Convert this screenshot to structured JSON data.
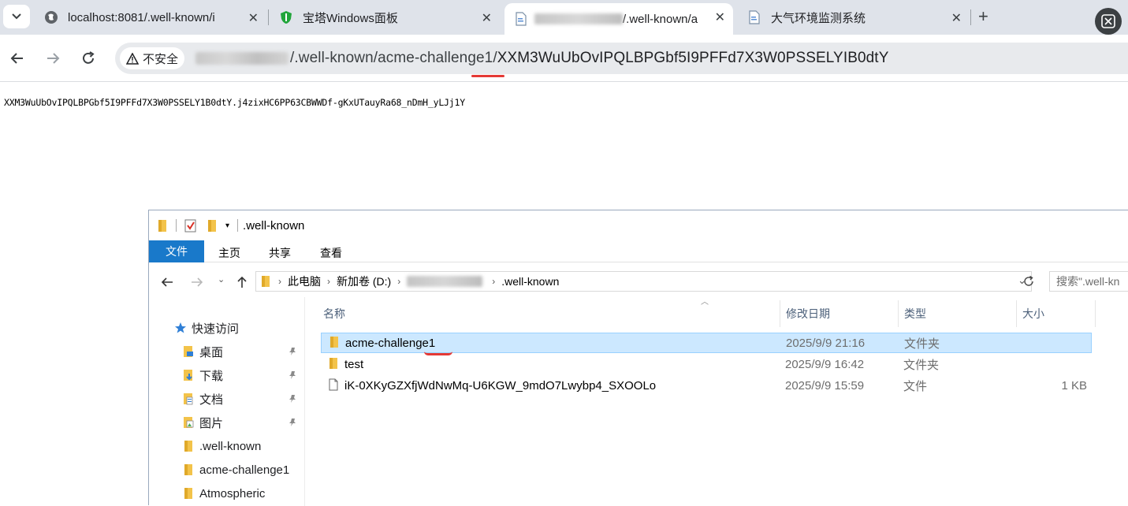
{
  "browser": {
    "tabs": [
      {
        "title": "localhost:8081/.well-known/i",
        "icon": "globe-icon",
        "active": false
      },
      {
        "title": "宝塔Windows面板",
        "icon": "bt-shield-icon",
        "active": false
      },
      {
        "title": "/.well-known/a",
        "icon": "page-icon",
        "active": true
      },
      {
        "title": "大气环境监测系统",
        "icon": "page-icon",
        "active": false
      }
    ],
    "address": {
      "security_label": "不安全",
      "url_path": "/.well-known/acme-challenge1/",
      "url_token": "XXM3WuUbOvIPQLBPGbf5I9PFFd7X3W0PSSELYIB0dtY"
    }
  },
  "page": {
    "body_text": "XXM3WuUbOvIPQLBPGbf5I9PFFd7X3W0PSSELY1B0dtY.j4zixHC6PP63CBWWDf-gKxUTauyRa68_nDmH_yLJj1Y"
  },
  "explorer": {
    "title": ".well-known",
    "ribbon": {
      "file": "文件",
      "home": "主页",
      "share": "共享",
      "view": "查看"
    },
    "breadcrumb": [
      "此电脑",
      "新加卷 (D:)",
      ".well-known"
    ],
    "search_placeholder": "搜索\".well-kn",
    "nav": {
      "quick_access": "快速访问",
      "items": [
        "桌面",
        "下载",
        "文档",
        "图片",
        ".well-known",
        "acme-challenge1",
        "Atmospheric"
      ]
    },
    "columns": {
      "name": "名称",
      "date": "修改日期",
      "type": "类型",
      "size": "大小"
    },
    "files": [
      {
        "name": "acme-challenge1",
        "date": "2025/9/9 21:16",
        "type": "文件夹",
        "size": ""
      },
      {
        "name": "test",
        "date": "2025/9/9 16:42",
        "type": "文件夹",
        "size": ""
      },
      {
        "name": "iK-0XKyGZXfjWdNwMq-U6KGW_9mdO7Lwybp4_SXOOLo",
        "date": "2025/9/9 15:59",
        "type": "文件",
        "size": "1 KB"
      }
    ]
  },
  "colors": {
    "accent": "#1979ca",
    "selection": "#cce8ff",
    "annotation": "#e53935",
    "folder": "#f3c34a"
  }
}
